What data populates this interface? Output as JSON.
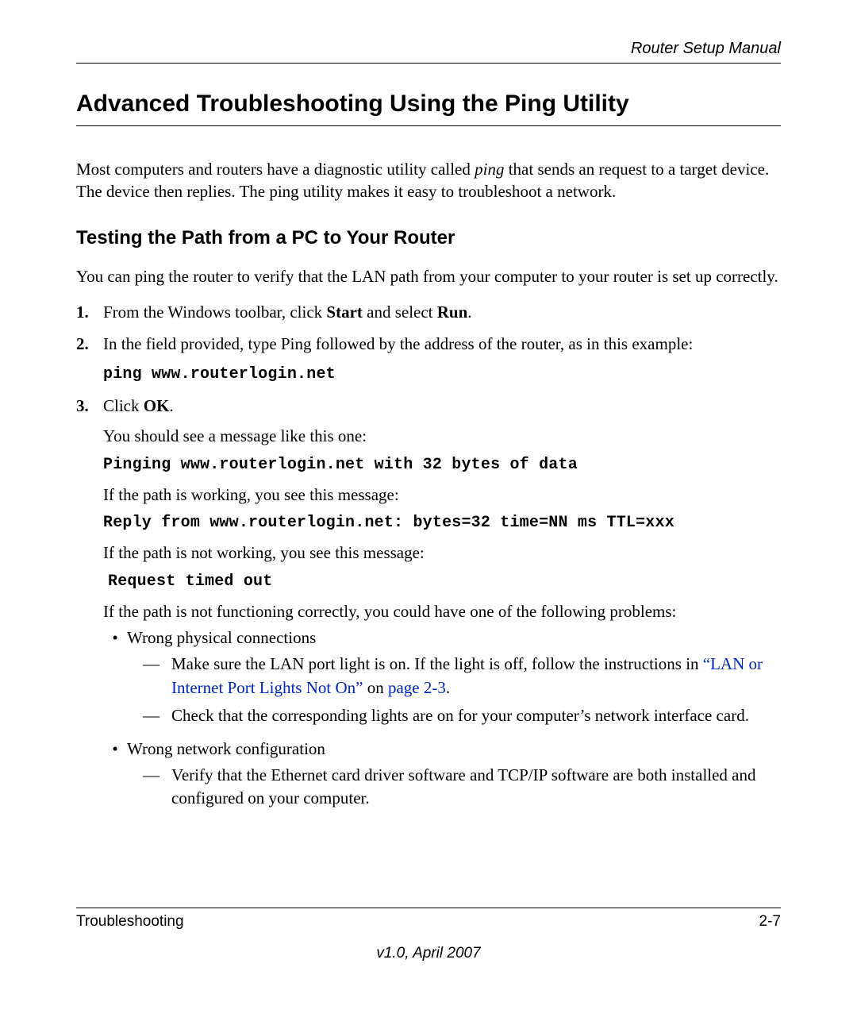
{
  "header": {
    "running_title": "Router Setup Manual"
  },
  "section": {
    "title": "Advanced Troubleshooting Using the Ping Utility",
    "intro_pre": "Most computers and routers have a diagnostic utility called ",
    "intro_em": "ping",
    "intro_post": " that sends an request to a target device. The device then replies. The ping utility makes it easy to troubleshoot a network."
  },
  "subsection": {
    "title": "Testing the Path from a PC to Your Router",
    "intro": "You can ping the router to verify that the LAN path from your computer to your router is set up correctly."
  },
  "steps": {
    "one": {
      "num": "1.",
      "pre": "From the Windows toolbar, click ",
      "bold1": "Start",
      "mid": " and select ",
      "bold2": "Run",
      "post": "."
    },
    "two": {
      "num": "2.",
      "text": "In the field provided, type Ping followed by the address of the router, as in this example:",
      "code": "ping www.routerlogin.net"
    },
    "three": {
      "num": "3.",
      "pre": "Click ",
      "bold": "OK",
      "post": ".",
      "line1": "You should see a message like this one:",
      "code1": "Pinging www.routerlogin.net with 32 bytes of data",
      "line2": "If the path is working, you see this message:",
      "code2": "Reply from www.routerlogin.net: bytes=32 time=NN ms TTL=xxx",
      "line3": "If the path is not working, you see this message:",
      "code3": "Request timed out",
      "line4": "If the path is not functioning correctly, you could have one of the following problems:"
    }
  },
  "bullets": {
    "b1": {
      "text": "Wrong physical connections",
      "d1_pre": "Make sure the LAN port light is on. If the light is off, follow the instructions in ",
      "d1_link1": "“LAN or Internet Port Lights Not On”",
      "d1_mid": " on ",
      "d1_link2": "page 2-3",
      "d1_post": ".",
      "d2": "Check that the corresponding lights are on for your computer’s network interface card."
    },
    "b2": {
      "text": "Wrong network configuration",
      "d1": "Verify that the Ethernet card driver software and TCP/IP software are both installed and configured on your computer."
    }
  },
  "footer": {
    "left": "Troubleshooting",
    "right": "2-7",
    "version": "v1.0, April 2007"
  },
  "glyphs": {
    "bullet": "•",
    "dash": "—"
  }
}
